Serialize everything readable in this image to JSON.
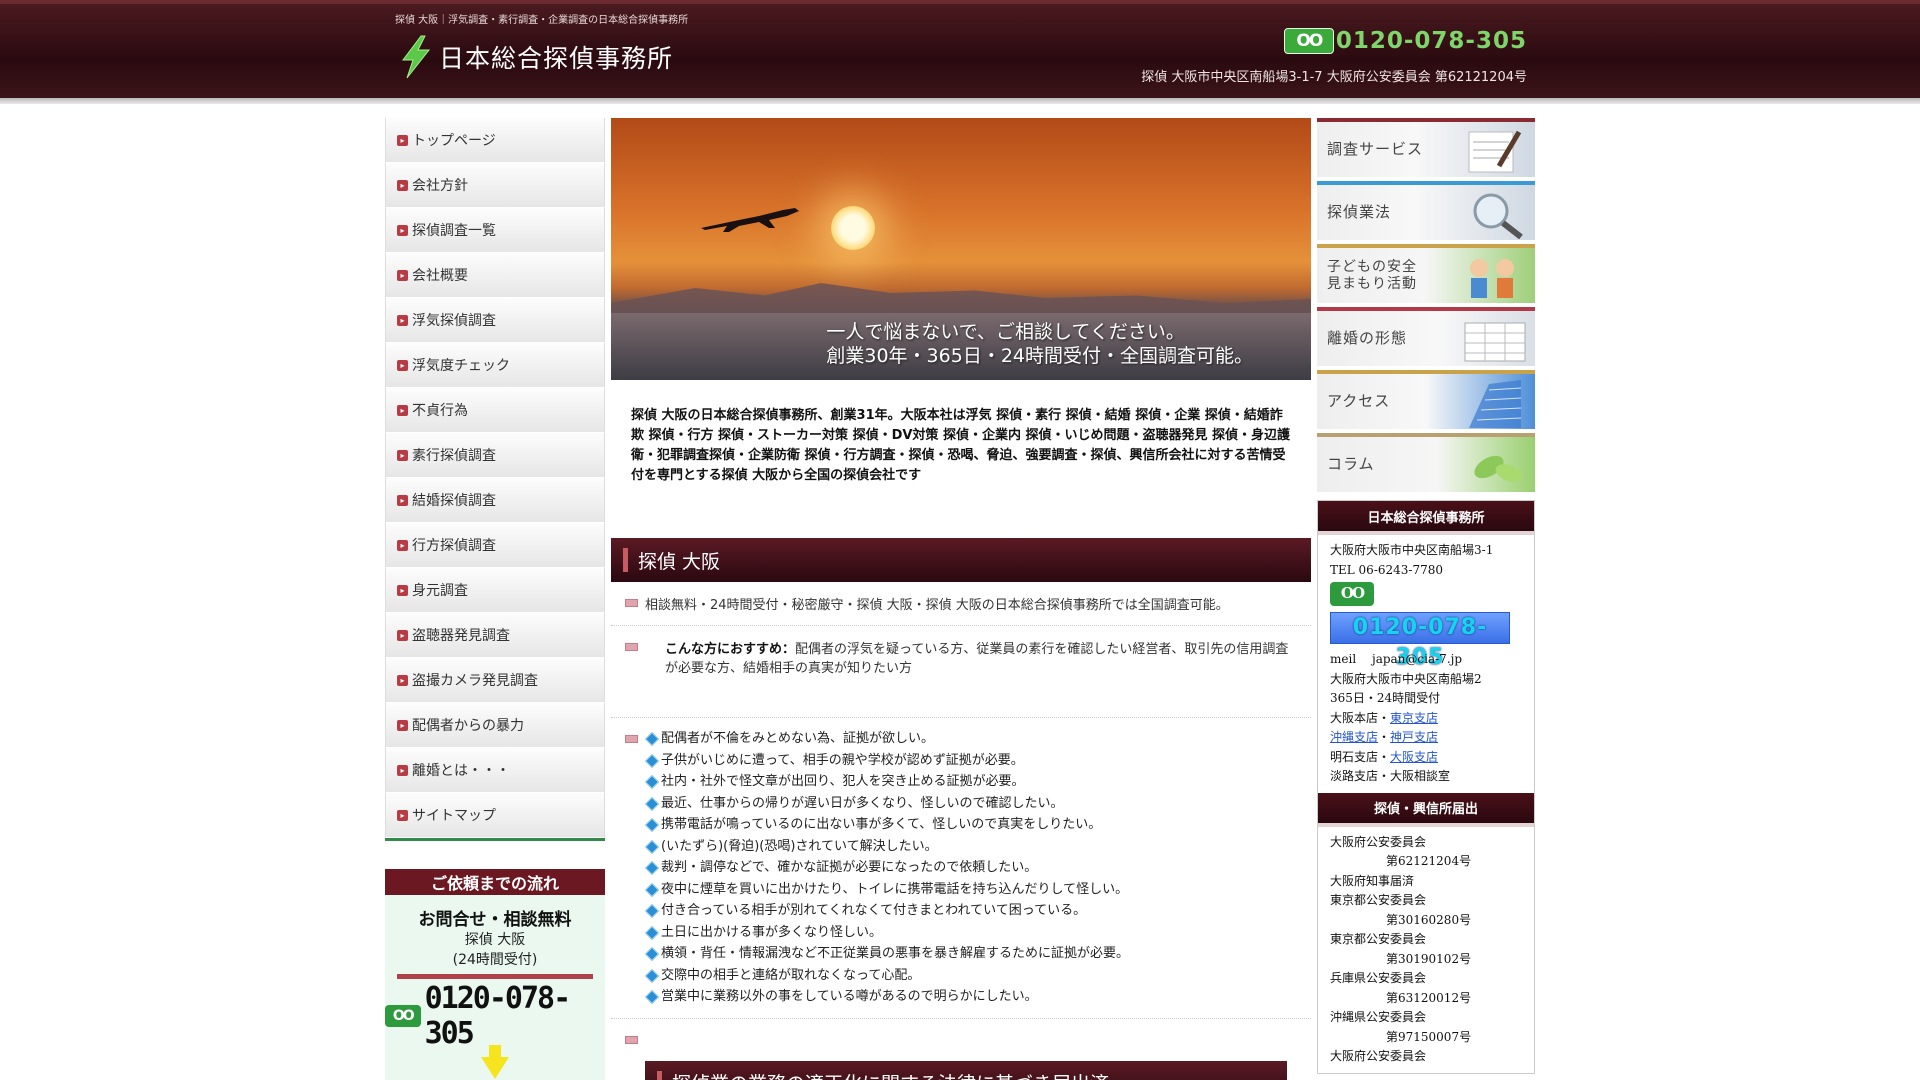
{
  "header": {
    "tagline": "探偵 大阪｜浮気調査・素行調査・企業調査の日本総合探偵事務所",
    "logo_text": "日本総合探偵事務所",
    "freedial_mark": "OO",
    "phone": "0120-078-305",
    "address": "探偵 大阪市中央区南船場3-1-7 大阪府公安委員会 第62121204号"
  },
  "nav": {
    "items": [
      "トップページ",
      "会社方針",
      "探偵調査一覧",
      "会社概要",
      "浮気探偵調査",
      "浮気度チェック",
      "不貞行為",
      "素行探偵調査",
      "結婚探偵調査",
      "行方探偵調査",
      "身元調査",
      "盗聴器発見調査",
      "盗撮カメラ発見調査",
      "配偶者からの暴力",
      "離婚とは・・・",
      "サイトマップ"
    ]
  },
  "flow": {
    "title": "ご依頼までの流れ",
    "subtitle": "お問合せ・相談無料",
    "line1": "探偵 大阪",
    "line2": "(24時間受付)",
    "phone": "0120-078-305"
  },
  "hero": {
    "line1": "一人で悩まないで、ご相談してください。",
    "line2": "創業30年・365日・24時間受付・全国調査可能。"
  },
  "intro": "探偵 大阪の日本総合探偵事務所、創業31年。大阪本社は浮気 探偵・素行 探偵・結婚 探偵・企業 探偵・結婚詐欺 探偵・行方 探偵・ストーカー対策 探偵・DV対策 探偵・企業内 探偵・いじめ問題・盗聴器発見 探偵・身辺護衛・犯罪調査探偵・企業防衛 探偵・行方調査・探偵・恐喝、脅迫、強要調査・探偵、興信所会社に対する苦情受付を専門とする探偵 大阪から全国の探偵会社です",
  "section1": {
    "title": "探偵 大阪",
    "row1": "相談無料・24時間受付・秘密厳守・探偵 大阪・探偵 大阪の日本総合探偵事務所では全国調査可能。",
    "rec_label": "こんな方におすすめ：",
    "rec_text": "配偶者の浮気を疑っている方、従業員の素行を確認したい経営者、取引先の信用調査が必要な方、結婚相手の真実が知りたい方",
    "list": [
      "配偶者が不倫をみとめない為、証拠が欲しい。",
      "子供がいじめに遭って、相手の親や学校が認めず証拠が必要。",
      "社内・社外で怪文章が出回り、犯人を突き止める証拠が必要。",
      "最近、仕事からの帰りが遅い日が多くなり、怪しいので確認したい。",
      "携帯電話が鳴っているのに出ない事が多くて、怪しいので真実をしりたい。",
      "(いたずら)(脅迫)(恐喝)されていて解決したい。",
      "裁判・調停などで、確かな証拠が必要になったので依頼したい。",
      "夜中に煙草を買いに出かけたり、トイレに携帯電話を持ち込んだりして怪しい。",
      "付き合っている相手が別れてくれなくて付きまとわれていて困っている。",
      "土日に出かける事が多くなり怪しい。",
      "横領・背任・情報漏洩など不正従業員の悪事を暴き解雇するために証拠が必要。",
      "交際中の相手と連絡が取れなくなって心配。",
      "営業中に業務以外の事をしている噂があるので明らかにしたい。"
    ]
  },
  "section2": {
    "title": "探偵業の業務の適正化に関する法律に基づき届出済"
  },
  "banners": [
    {
      "label": "調査サービス"
    },
    {
      "label": "探偵業法"
    },
    {
      "label": "子どもの安全",
      "label2": "見まもり活動"
    },
    {
      "label": "離婚の形態"
    },
    {
      "label": "アクセス"
    },
    {
      "label": "コラム"
    }
  ],
  "info": {
    "title": "日本総合探偵事務所",
    "address": "大阪府大阪市中央区南船場3-1",
    "tel": "TEL 06-6243-7780",
    "freedial_mark": "OO",
    "phone": "0120-078-305",
    "mail": "meil　 japan@cia-7.jp",
    "address2": "大阪府大阪市中央区南船場2",
    "hours": "365日・24時間受付",
    "branch_head": "大阪本店・",
    "branch_tokyo": "東京支店",
    "branch_okinawa": "沖縄支店",
    "sep": "・",
    "branch_kobe": "神戸支店",
    "branch_akashi": "明石支店・",
    "branch_osaka": "大阪支店",
    "branch_awaji": "淡路支店・大阪相談室"
  },
  "registry": {
    "title": "探偵・興信所届出",
    "entries": [
      {
        "office": "大阪府公安委員会",
        "number": "第62121204号"
      },
      {
        "office": "大阪府知事届済",
        "number": ""
      },
      {
        "office": "東京都公安委員会",
        "number": "第30160280号"
      },
      {
        "office": "東京都公安委員会",
        "number": "第30190102号"
      },
      {
        "office": "兵庫県公安委員会",
        "number": "第63120012号"
      },
      {
        "office": "沖縄県公安委員会",
        "number": "第97150007号"
      },
      {
        "office": "大阪府公安委員会",
        "number": ""
      }
    ]
  },
  "colors": {
    "header_bg": "#2a0a10",
    "accent_green": "#2e9a3e",
    "nav_border": "#2f8a4b"
  }
}
